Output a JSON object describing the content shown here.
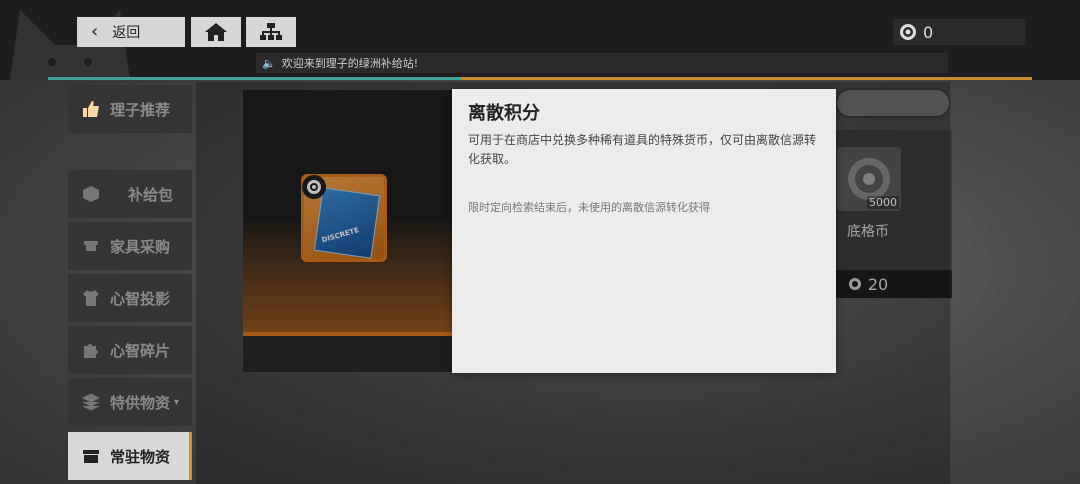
{
  "header": {
    "back_label": "返回",
    "currency_value": "0",
    "notice_text": "欢迎来到理子的绿洲补给站!",
    "notice_progress": 0.42
  },
  "sidebar": {
    "items": [
      {
        "label": "理子推荐",
        "icon": "thumbs-up-icon",
        "state": "active"
      },
      {
        "label": "补给包",
        "icon": "box-icon",
        "state": "normal"
      },
      {
        "label": "家具采购",
        "icon": "furniture-icon",
        "state": "normal"
      },
      {
        "label": "心智投影",
        "icon": "shirt-icon",
        "state": "normal"
      },
      {
        "label": "心智碎片",
        "icon": "puzzle-icon",
        "state": "normal"
      },
      {
        "label": "特供物资",
        "icon": "layers-icon",
        "state": "normal"
      },
      {
        "label": "常驻物资",
        "icon": "crate-icon",
        "state": "current"
      }
    ]
  },
  "item_preview": {
    "cover_text": "DISCRETE"
  },
  "shop_card": {
    "quantity": "5000",
    "name": "底格币",
    "price": "20"
  },
  "tooltip": {
    "title": "离散积分",
    "description": "可用于在商店中兑换多种稀有道具的特殊货币，仅可由离散信源转化获取。",
    "note": "限时定向检索结束后，未使用的离散信源转化获得"
  },
  "colors": {
    "accent": "#e07a1e",
    "teal": "#3fa39a",
    "popup_bg": "#ececec"
  }
}
